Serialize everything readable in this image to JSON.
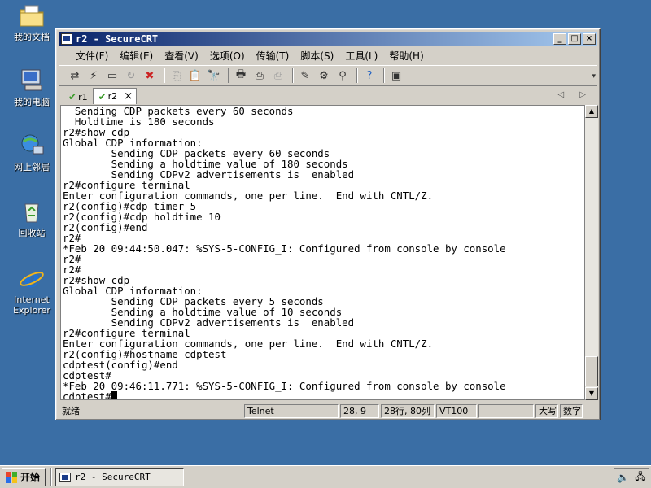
{
  "desktop": {
    "icons": [
      {
        "label": "我的文档",
        "icon": "my-documents-icon"
      },
      {
        "label": "我的电脑",
        "icon": "my-computer-icon"
      },
      {
        "label": "网上邻居",
        "icon": "network-places-icon"
      },
      {
        "label": "回收站",
        "icon": "recycle-bin-icon"
      },
      {
        "label": "Internet Explorer",
        "icon": "internet-explorer-icon"
      }
    ]
  },
  "window": {
    "title": "r2 - SecureCRT",
    "minimize": "_",
    "maximize": "□",
    "close": "×"
  },
  "menu": [
    "文件(F)",
    "编辑(E)",
    "查看(V)",
    "选项(O)",
    "传输(T)",
    "脚本(S)",
    "工具(L)",
    "帮助(H)"
  ],
  "tabs": [
    {
      "label": "r1",
      "active": false
    },
    {
      "label": "r2",
      "active": true,
      "close": "×"
    }
  ],
  "tab_nav": "◁ ▷",
  "terminal": {
    "lines": [
      "  Sending CDP packets every 60 seconds",
      "  Holdtime is 180 seconds",
      "r2#show cdp",
      "Global CDP information:",
      "        Sending CDP packets every 60 seconds",
      "        Sending a holdtime value of 180 seconds",
      "        Sending CDPv2 advertisements is  enabled",
      "r2#configure terminal",
      "Enter configuration commands, one per line.  End with CNTL/Z.",
      "r2(config)#cdp timer 5",
      "r2(config)#cdp holdtime 10",
      "r2(config)#end",
      "r2#",
      "*Feb 20 09:44:50.047: %SYS-5-CONFIG_I: Configured from console by console",
      "r2#",
      "r2#",
      "r2#show cdp",
      "Global CDP information:",
      "        Sending CDP packets every 5 seconds",
      "        Sending a holdtime value of 10 seconds",
      "        Sending CDPv2 advertisements is  enabled",
      "r2#configure terminal",
      "Enter configuration commands, one per line.  End with CNTL/Z.",
      "r2(config)#hostname cdptest",
      "cdptest(config)#end",
      "cdptest#",
      "*Feb 20 09:46:11.771: %SYS-5-CONFIG_I: Configured from console by console"
    ],
    "prompt": "cdptest#"
  },
  "status": {
    "ready": "就绪",
    "protocol": "Telnet",
    "cursor": "28,  9",
    "size": "28行, 80列",
    "emulation": "VT100",
    "blank": "",
    "caps": "大写",
    "num": "数字"
  },
  "taskbar": {
    "start": "开始",
    "task": "r2 - SecureCRT"
  }
}
